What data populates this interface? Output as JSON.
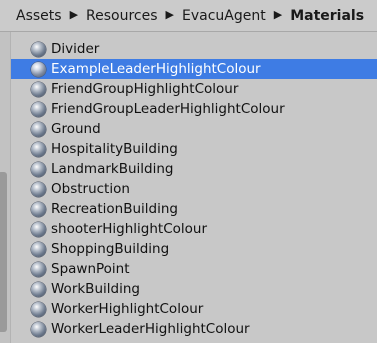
{
  "breadcrumb": {
    "items": [
      "Assets",
      "Resources",
      "EvacuAgent",
      "Materials"
    ],
    "separator": "▶"
  },
  "selected_index": 1,
  "items": [
    "Divider",
    "ExampleLeaderHighlightColour",
    "FriendGroupHighlightColour",
    "FriendGroupLeaderHighlightColour",
    "Ground",
    "HospitalityBuilding",
    "LandmarkBuilding",
    "Obstruction",
    "RecreationBuilding",
    "shooterHighlightColour",
    "ShoppingBuilding",
    "SpawnPoint",
    "WorkBuilding",
    "WorkerHighlightColour",
    "WorkerLeaderHighlightColour"
  ],
  "colors": {
    "selection": "#3e7ce4",
    "panel_background": "#c8c8c8"
  },
  "item_icon": "material-sphere-icon"
}
